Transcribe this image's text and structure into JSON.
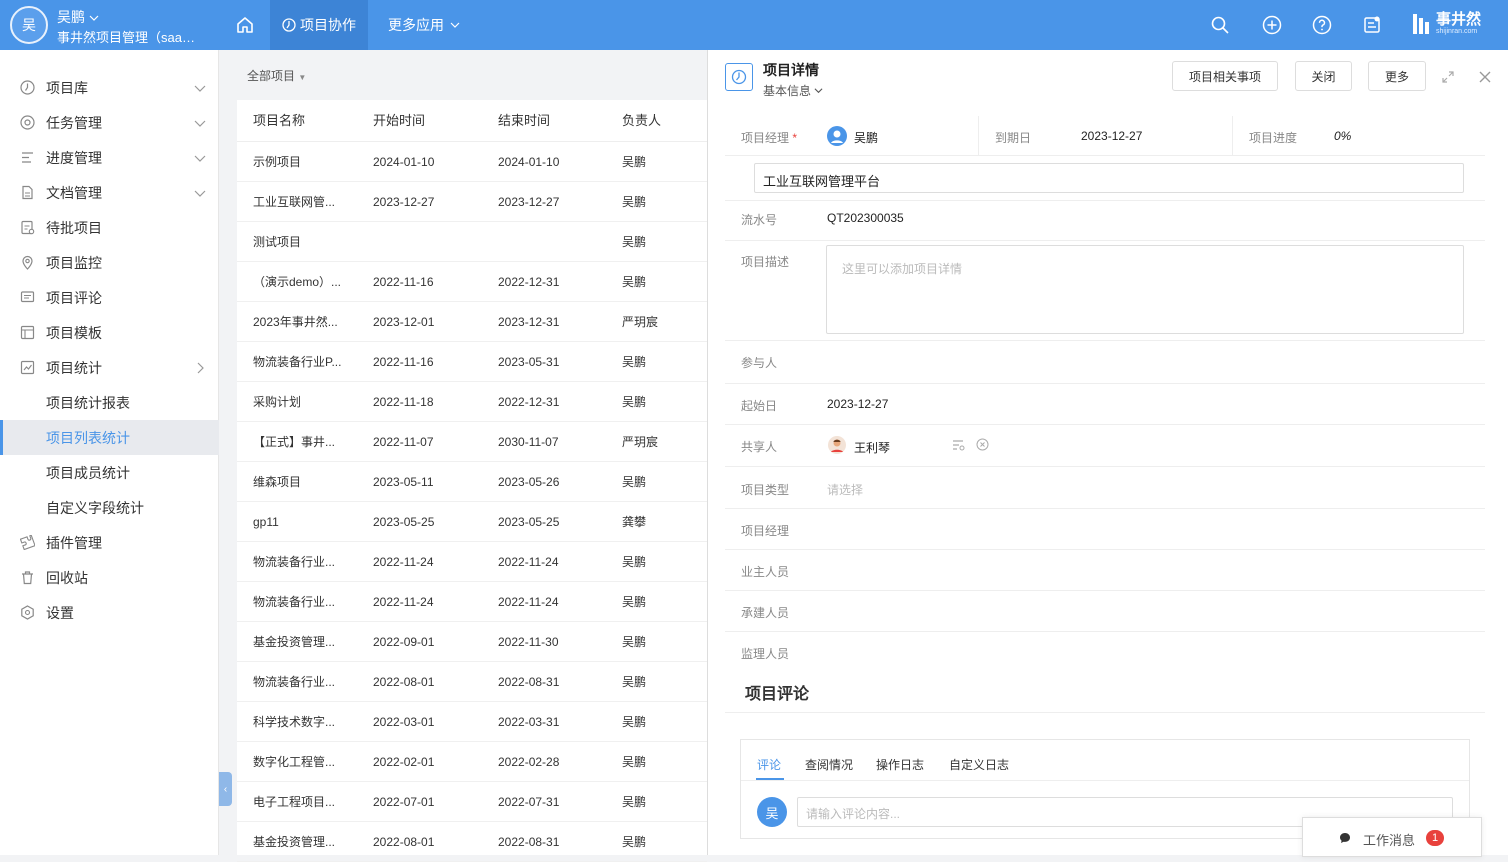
{
  "topbar": {
    "avatar_initial": "吴",
    "user_name": "吴鹏",
    "org_name": "事井然项目管理（saas...",
    "nav_active": "项目协作",
    "nav_more": "更多应用",
    "brand_name": "事井然",
    "brand_sub": "shijinran.com"
  },
  "sidebar": {
    "items": [
      {
        "label": "项目库",
        "icon": "clock-icon",
        "chevron": "down"
      },
      {
        "label": "任务管理",
        "icon": "at-icon",
        "chevron": "down"
      },
      {
        "label": "进度管理",
        "icon": "progress-icon",
        "chevron": "down"
      },
      {
        "label": "文档管理",
        "icon": "document-icon",
        "chevron": "down"
      },
      {
        "label": "待批项目",
        "icon": "approval-icon"
      },
      {
        "label": "项目监控",
        "icon": "location-icon"
      },
      {
        "label": "项目评论",
        "icon": "comment-icon"
      },
      {
        "label": "项目模板",
        "icon": "template-icon"
      },
      {
        "label": "项目统计",
        "icon": "stats-icon",
        "chevron": "right"
      },
      {
        "label": "项目统计报表"
      },
      {
        "label": "项目列表统计",
        "active": true
      },
      {
        "label": "项目成员统计"
      },
      {
        "label": "自定义字段统计"
      },
      {
        "label": "插件管理",
        "icon": "plugin-icon"
      },
      {
        "label": "回收站",
        "icon": "trash-icon"
      },
      {
        "label": "设置",
        "icon": "settings-icon"
      }
    ]
  },
  "list": {
    "filter_label": "全部项目",
    "columns": [
      "项目名称",
      "开始时间",
      "结束时间",
      "负责人"
    ],
    "rows": [
      [
        "示例项目",
        "2024-01-10",
        "2024-01-10",
        "吴鹏"
      ],
      [
        "工业互联网管...",
        "2023-12-27",
        "2023-12-27",
        "吴鹏"
      ],
      [
        "测试项目",
        "",
        "",
        "吴鹏"
      ],
      [
        "（演示demo）...",
        "2022-11-16",
        "2022-12-31",
        "吴鹏"
      ],
      [
        "2023年事井然...",
        "2023-12-01",
        "2023-12-31",
        "严玥宸"
      ],
      [
        "物流装备行业P...",
        "2022-11-16",
        "2023-05-31",
        "吴鹏"
      ],
      [
        "采购计划",
        "2022-11-18",
        "2022-12-31",
        "吴鹏"
      ],
      [
        "【正式】事井...",
        "2022-11-07",
        "2030-11-07",
        "严玥宸"
      ],
      [
        "维森项目",
        "2023-05-11",
        "2023-05-26",
        "吴鹏"
      ],
      [
        "gp11",
        "2023-05-25",
        "2023-05-25",
        "龚攀"
      ],
      [
        "物流装备行业...",
        "2022-11-24",
        "2022-11-24",
        "吴鹏"
      ],
      [
        "物流装备行业...",
        "2022-11-24",
        "2022-11-24",
        "吴鹏"
      ],
      [
        "基金投资管理...",
        "2022-09-01",
        "2022-11-30",
        "吴鹏"
      ],
      [
        "物流装备行业...",
        "2022-08-01",
        "2022-08-31",
        "吴鹏"
      ],
      [
        "科学技术数字...",
        "2022-03-01",
        "2022-03-31",
        "吴鹏"
      ],
      [
        "数字化工程管...",
        "2022-02-01",
        "2022-02-28",
        "吴鹏"
      ],
      [
        "电子工程项目...",
        "2022-07-01",
        "2022-07-31",
        "吴鹏"
      ],
      [
        "基金投资管理...",
        "2022-08-01",
        "2022-08-31",
        "吴鹏"
      ]
    ]
  },
  "detail": {
    "title": "项目详情",
    "subtitle": "基本信息",
    "btn_related": "项目相关事项",
    "btn_close": "关闭",
    "btn_more": "更多",
    "manager_label": "项目经理",
    "required_mark": "*",
    "manager_value": "吴鹏",
    "due_label": "到期日",
    "due_value": "2023-12-27",
    "progress_label": "项目进度",
    "progress_value": "0%",
    "project_name": "工业互联网管理平台",
    "serial_label": "流水号",
    "serial_value": "QT202300035",
    "desc_label": "项目描述",
    "desc_placeholder": "这里可以添加项目详情",
    "participants_label": "参与人",
    "start_label": "起始日",
    "start_value": "2023-12-27",
    "share_label": "共享人",
    "share_value": "王利琴",
    "type_label": "项目类型",
    "type_placeholder": "请选择",
    "manager2_label": "项目经理",
    "owner_label": "业主人员",
    "contractor_label": "承建人员",
    "supervisor_label": "监理人员",
    "comments_title": "项目评论",
    "tabs": [
      "评论",
      "查阅情况",
      "操作日志",
      "自定义日志"
    ],
    "comment_avatar": "吴",
    "comment_placeholder": "请输入评论内容..."
  },
  "message_popup": {
    "label": "工作消息",
    "count": "1"
  },
  "colors": {
    "primary": "#4a95e8",
    "badge": "#e8413c"
  }
}
